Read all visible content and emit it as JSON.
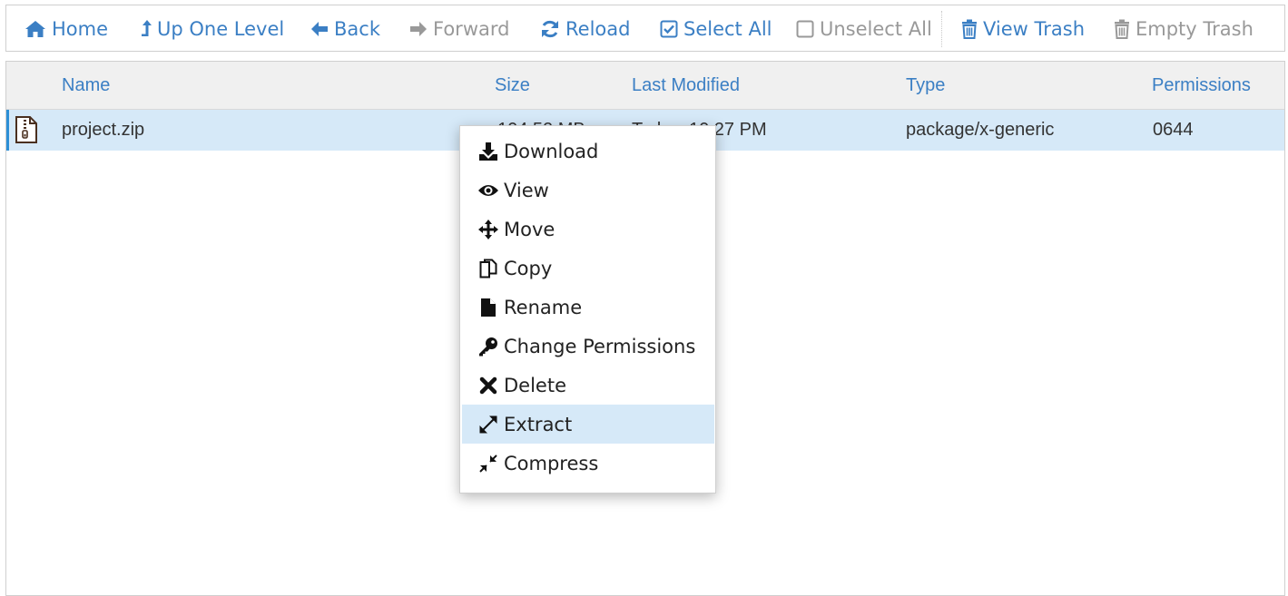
{
  "toolbar": {
    "home": "Home",
    "up": "Up One Level",
    "back": "Back",
    "forward": "Forward",
    "reload": "Reload",
    "select_all": "Select All",
    "unselect_all": "Unselect All",
    "view_trash": "View Trash",
    "empty_trash": "Empty Trash"
  },
  "table": {
    "columns": [
      "Name",
      "Size",
      "Last Modified",
      "Type",
      "Permissions"
    ],
    "rows": [
      {
        "icon": "zip-file-icon",
        "name": "project.zip",
        "size": "104.52 MB",
        "modified": "Today, 10:27 PM",
        "type": "package/x-generic",
        "permissions": "0644"
      }
    ]
  },
  "context_menu": {
    "items": [
      {
        "label": "Download",
        "icon": "download-icon"
      },
      {
        "label": "View",
        "icon": "eye-icon"
      },
      {
        "label": "Move",
        "icon": "move-arrows-icon"
      },
      {
        "label": "Copy",
        "icon": "copy-icon"
      },
      {
        "label": "Rename",
        "icon": "file-icon"
      },
      {
        "label": "Change Permissions",
        "icon": "key-icon"
      },
      {
        "label": "Delete",
        "icon": "x-icon"
      },
      {
        "label": "Extract",
        "icon": "expand-icon",
        "highlighted": true
      },
      {
        "label": "Compress",
        "icon": "compress-icon"
      }
    ]
  },
  "colors": {
    "accent": "#3b7fc4",
    "disabled": "#999999",
    "selected_row": "#d6e9f8",
    "selected_border": "#2c8fd6"
  }
}
